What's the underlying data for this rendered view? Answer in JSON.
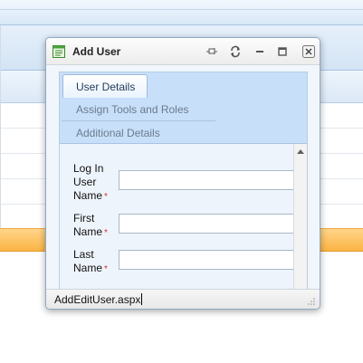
{
  "dialog": {
    "title": "Add User",
    "icons": [
      "form-icon",
      "pin-icon",
      "reload-icon",
      "minimize-icon",
      "maximize-icon",
      "close-icon"
    ]
  },
  "tabs": [
    {
      "label": "User Details",
      "active": true
    },
    {
      "label": "Assign Tools and Roles",
      "active": false
    },
    {
      "label": "Additional Details",
      "active": false
    }
  ],
  "form": {
    "required_marker": "*",
    "fields": [
      {
        "label": "Log In User Name",
        "value": ""
      },
      {
        "label": "First Name",
        "value": ""
      },
      {
        "label": "Last Name",
        "value": ""
      }
    ]
  },
  "status": {
    "text": "AddEditUser.aspx"
  },
  "colors": {
    "highlight_row": "#fbb444",
    "tab_strip": "#c8dffa",
    "required": "#d32f2f"
  }
}
